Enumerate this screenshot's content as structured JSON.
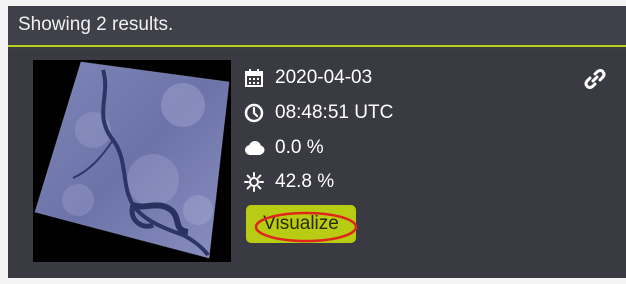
{
  "header": {
    "results_text": "Showing 2 results."
  },
  "result": {
    "thumbnail_icon": "satellite-scene-image",
    "date": "2020-04-03",
    "time": "08:48:51 UTC",
    "cloud_cover": "0.0 %",
    "sun_elevation": "42.8 %",
    "visualize_label": "Visualize",
    "link_icon": "link-icon"
  },
  "colors": {
    "panel_bg": "#3b3c44",
    "accent": "#b9cf1d",
    "button_bg": "#b7cc12",
    "highlight": "#e0251b"
  }
}
